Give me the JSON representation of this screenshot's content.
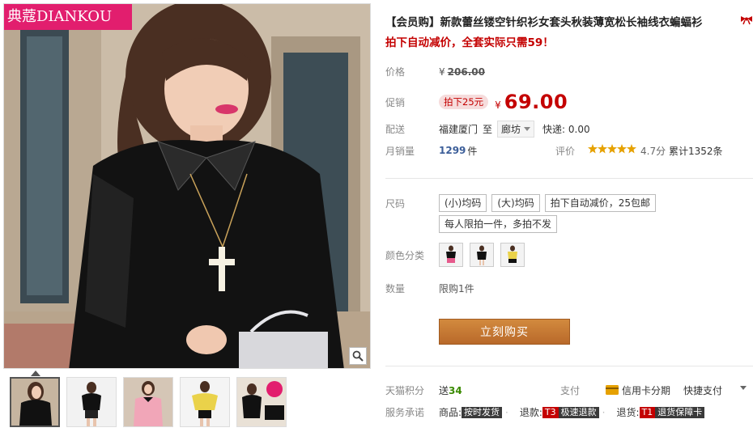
{
  "brand": {
    "logo_text": "典蔻DIANKOU"
  },
  "product": {
    "title": "【会员购】新款蕾丝镂空针织衫女套头秋装薄宽松长袖线衣蝙蝠衫",
    "subtitle": "拍下自动减价，全套实际只需59！"
  },
  "price": {
    "label": "价格",
    "currency": "¥",
    "original": "206.00"
  },
  "promo": {
    "label": "促销",
    "tag": "拍下25元",
    "currency": "¥",
    "price": "69.00"
  },
  "delivery": {
    "label": "配送",
    "from": "福建厦门",
    "to_word": "至",
    "to": "廊坊",
    "fee": "快递: 0.00"
  },
  "sales": {
    "label": "月销量",
    "count": "1299",
    "unit": "件",
    "rating_label": "评价",
    "stars": 5,
    "rating": "4.7分",
    "reviews": "累计1352条"
  },
  "size": {
    "label": "尺码",
    "options": [
      "(小)均码",
      "(大)均码",
      "拍下自动减价，25包邮",
      "每人限拍一件，多拍不发"
    ]
  },
  "color": {
    "label": "颜色分类",
    "swatches": [
      "black-top-pink-skirt",
      "black-top",
      "yellow-top"
    ]
  },
  "quantity": {
    "label": "数量",
    "limit": "限购1件"
  },
  "buy_button": "立刻购买",
  "points": {
    "label": "天猫积分",
    "prefix": "送",
    "value": "34"
  },
  "payment": {
    "label": "支付",
    "credit": "信用卡分期",
    "fast": "快捷支付"
  },
  "service": {
    "label": "服务承诺",
    "items": [
      {
        "prefix": "商品:",
        "tag": "",
        "text": "按时发货"
      },
      {
        "prefix": "退款:",
        "tag": "T3",
        "text": "极速退款"
      },
      {
        "prefix": "退货:",
        "tag": "T1",
        "text": "退货保障卡"
      }
    ]
  },
  "colors": {
    "accent": "#c40000",
    "buy": "#c27a36",
    "brand": "#e21e6e"
  }
}
